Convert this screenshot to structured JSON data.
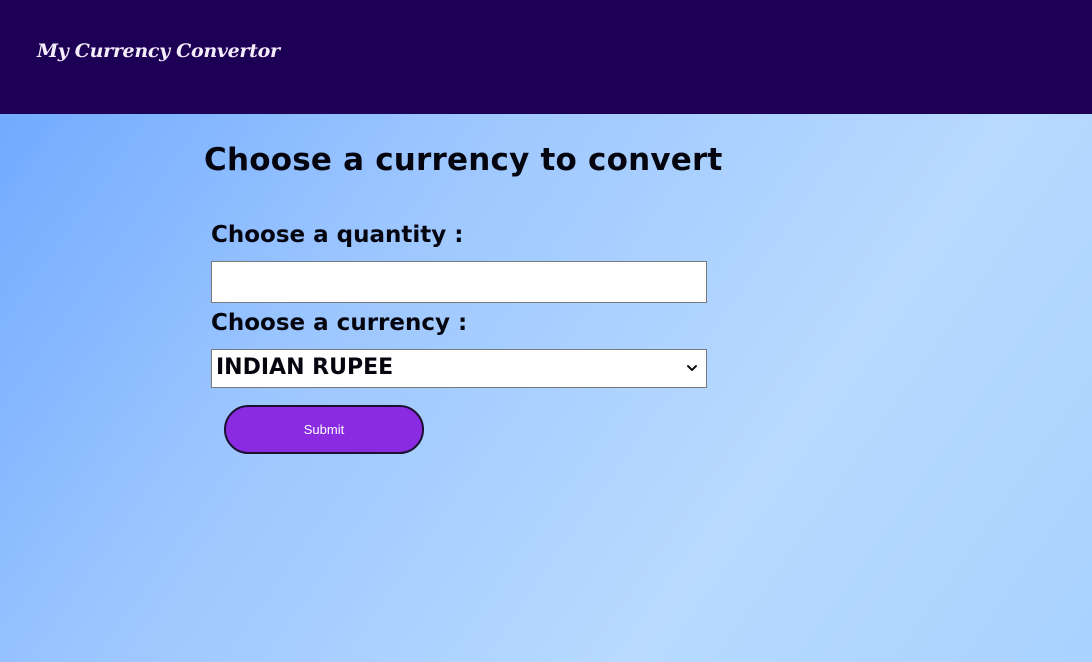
{
  "navbar": {
    "brand": "My Currency Convertor",
    "background": "#1d0055"
  },
  "main": {
    "title": "Choose a currency to convert",
    "form": {
      "quantity_label": "Choose a quantity :",
      "quantity_value": "",
      "currency_label": "Choose a currency :",
      "currency_selected": "INDIAN RUPEE",
      "submit_label": "Submit",
      "submit_color": "#8a2be2"
    }
  }
}
